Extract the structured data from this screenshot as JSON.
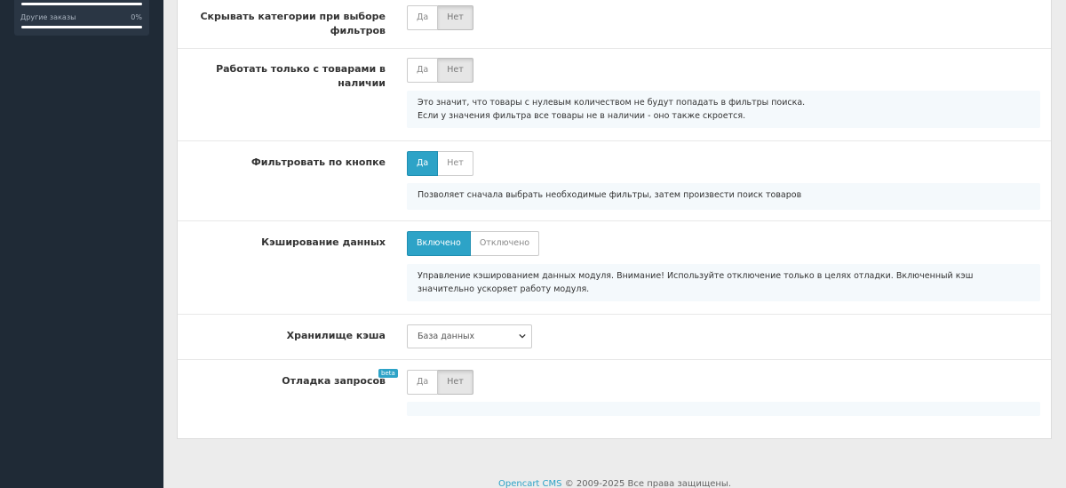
{
  "sidebar": {
    "stats": {
      "label": "Другие заказы",
      "value": "0%"
    }
  },
  "settings": {
    "hide_categories": {
      "label": "Скрывать категории при выборе фильтров",
      "yes": "Да",
      "no": "Нет",
      "selected": "no"
    },
    "in_stock_only": {
      "label": "Работать только с товарами в наличии",
      "yes": "Да",
      "no": "Нет",
      "selected": "no",
      "help_line1": "Это значит, что товары с нулевым количеством не будут попадать в фильтры поиска.",
      "help_line2": "Если у значения фильтра все товары не в наличии - оно также скроется."
    },
    "filter_by_button": {
      "label": "Фильтровать по кнопке",
      "yes": "Да",
      "no": "Нет",
      "selected": "yes",
      "help": "Позволяет сначала выбрать необходимые фильтры, затем произвести поиск товаров"
    },
    "data_caching": {
      "label": "Кэширование данных",
      "on": "Включено",
      "off": "Отключено",
      "selected": "on",
      "help": "Управление кэшированием данных модуля. Внимание! Используйте отключение только в целях отладки. Включенный кэш значительно ускоряет работу модуля."
    },
    "cache_storage": {
      "label": "Хранилище кэша",
      "value": "База данных"
    },
    "debug_queries": {
      "label": "Отладка запросов",
      "badge": "beta",
      "yes": "Да",
      "no": "Нет",
      "selected": "no"
    }
  },
  "footer": {
    "link": "Opencart CMS",
    "text": "© 2009-2025 Все права защищены."
  },
  "colors": {
    "accent": "#2da3c7",
    "sidebar_bg": "#1f2a36",
    "help_bg": "#f4f9fc"
  }
}
